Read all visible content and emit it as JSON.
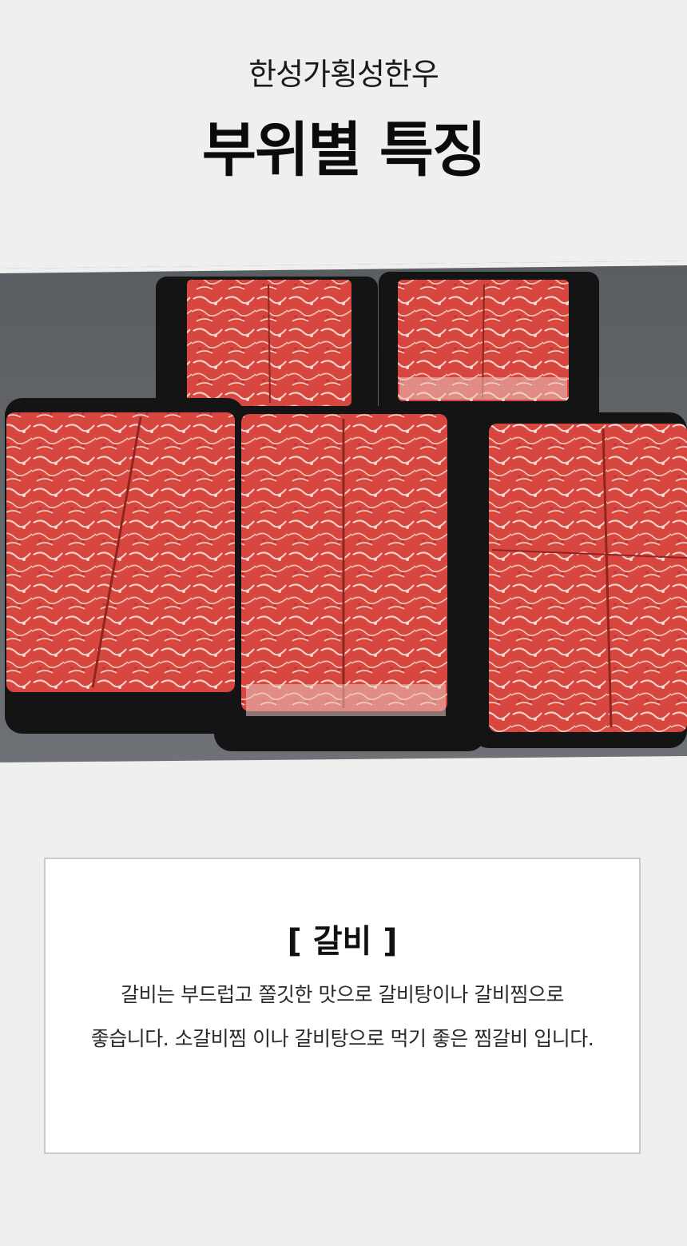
{
  "header": {
    "brand": "한성가횡성한우",
    "title": "부위별 특징"
  },
  "section": {
    "heading": "[ 갈비 ]",
    "description_lines": [
      "갈비는 부드럽고 쫄깃한 맛으로 갈비탕이나 갈비찜으로",
      "좋습니다. 소갈비찜 이나 갈비탕으로 먹기 좋은 찜갈비 입니다."
    ]
  },
  "colors": {
    "background": "#efefef",
    "meat": "#d8473f",
    "tray": "#141414",
    "card_border": "#c9c9c9"
  }
}
